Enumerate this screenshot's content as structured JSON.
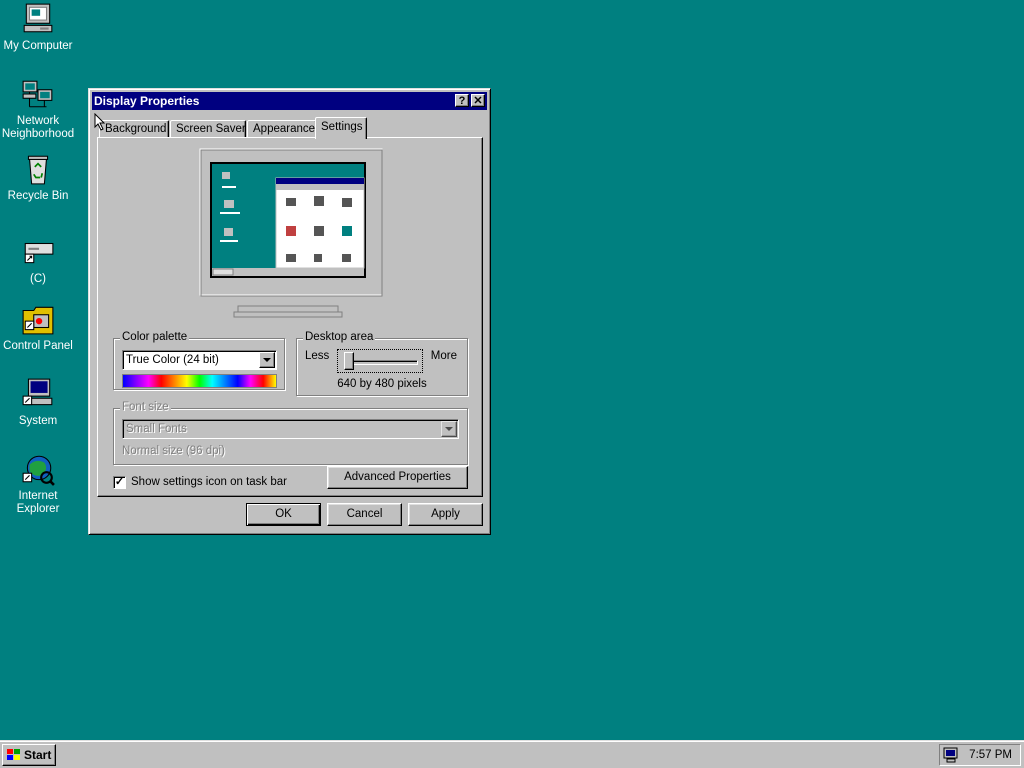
{
  "desktop": {
    "icons": [
      {
        "label_lines": [
          "My Computer"
        ],
        "icon": "my-computer-icon"
      },
      {
        "label_lines": [
          "Network",
          "Neighborhood"
        ],
        "icon": "network-neighborhood-icon"
      },
      {
        "label_lines": [
          "Recycle Bin"
        ],
        "icon": "recycle-bin-icon"
      },
      {
        "label_lines": [
          "(C)"
        ],
        "icon": "drive-c-shortcut-icon"
      },
      {
        "label_lines": [
          "Control Panel"
        ],
        "icon": "control-panel-icon"
      },
      {
        "label_lines": [
          "System"
        ],
        "icon": "system-shortcut-icon"
      },
      {
        "label_lines": [
          "Internet",
          "Explorer"
        ],
        "icon": "internet-explorer-icon"
      }
    ],
    "background_color": "#008080"
  },
  "window": {
    "title": "Display Properties",
    "help_glyph": "?",
    "close_glyph": "✕",
    "tabs": [
      "Background",
      "Screen Saver",
      "Appearance",
      "Settings"
    ],
    "active_tab": "Settings",
    "color_palette": {
      "legend": "Color palette",
      "selected": "True Color (24 bit)"
    },
    "desktop_area": {
      "legend": "Desktop area",
      "less_label": "Less",
      "more_label": "More",
      "resolution": "640 by 480 pixels",
      "slider_position": 0
    },
    "font_size": {
      "legend": "Font size",
      "selected": "Small Fonts",
      "note": "Normal size (96 dpi)",
      "enabled": false
    },
    "show_settings_icon": {
      "label": "Show settings icon on task bar",
      "checked": true
    },
    "advanced_button": "Advanced Properties",
    "buttons": {
      "ok": "OK",
      "cancel": "Cancel",
      "apply": "Apply"
    }
  },
  "taskbar": {
    "start_label": "Start",
    "clock": "7:57 PM"
  },
  "colors": {
    "title_bar": "#000080",
    "face": "#c0c0c0"
  }
}
